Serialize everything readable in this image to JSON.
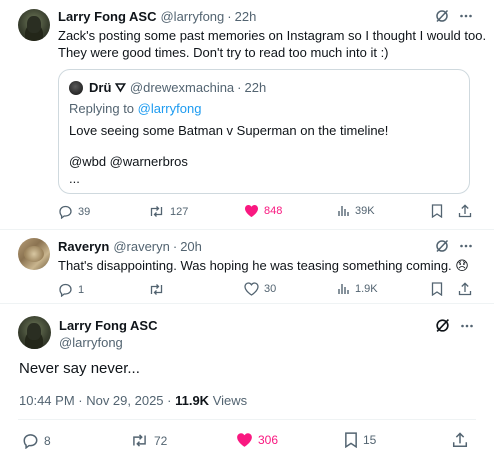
{
  "tweet1": {
    "name": "Larry Fong ASC",
    "handle": "@larryfong",
    "sep": "·",
    "time": "22h",
    "text_line1": "Zack's posting some past memories on Instagram so I thought I would too.",
    "text_line2": "They were good times. Don't try to read too much into it :)",
    "quote": {
      "name": "Drü ⛛",
      "handle": "@drewexmachina",
      "sep": "·",
      "time": "22h",
      "replying_prefix": "Replying to ",
      "replying_mention": "@larryfong",
      "line1": "Love seeing some Batman v Superman on the timeline!",
      "line2": "@wbd @warnerbros",
      "line3": "..."
    },
    "actions": {
      "replies": "39",
      "reposts": "127",
      "likes": "848",
      "views": "39K"
    }
  },
  "tweet2": {
    "name": "Raveryn",
    "handle": "@raveryn",
    "sep": "·",
    "time": "20h",
    "text": "That's disappointing. Was hoping he was teasing something coming. 😞",
    "actions": {
      "replies": "1",
      "reposts": "",
      "likes": "30",
      "views": "1.9K"
    }
  },
  "main": {
    "name": "Larry Fong ASC",
    "handle": "@larryfong",
    "text": "Never say never...",
    "timestamp": "10:44 PM · Nov 29, 2025 · ",
    "views_count": "11.9K",
    "views_label": " Views",
    "actions": {
      "replies": "8",
      "reposts": "72",
      "likes": "306",
      "bookmarks": "15"
    }
  },
  "colors": {
    "like_pink": "#f91880",
    "secondary_text": "#536471",
    "mention_blue": "#1d9bf0",
    "border": "#cfd9de"
  },
  "icons": [
    "grok-icon",
    "more-icon",
    "reply-icon",
    "repost-icon",
    "like-icon",
    "views-icon",
    "bookmark-icon",
    "share-icon"
  ]
}
